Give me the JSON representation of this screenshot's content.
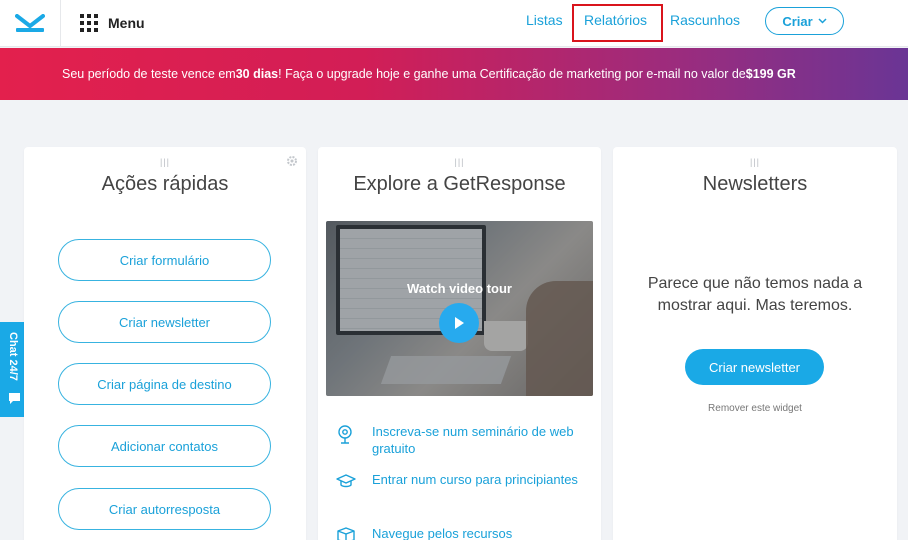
{
  "nav": {
    "menu_label": "Menu",
    "links": [
      "Listas",
      "Relatórios",
      "Rascunhos"
    ],
    "create_label": "Criar"
  },
  "banner": {
    "part1": "Seu período de teste vence em ",
    "days": "30 dias",
    "part2": "! Faça o upgrade hoje e ganhe uma Certificação de marketing por e-mail no valor de ",
    "price": "$199 GR"
  },
  "quick_actions": {
    "title": "Ações rápidas",
    "buttons": [
      "Criar formulário",
      "Criar newsletter",
      "Criar página de destino",
      "Adicionar contatos",
      "Criar autorresposta"
    ]
  },
  "explore": {
    "title": "Explore a GetResponse",
    "video_label": "Watch video tour",
    "resources": [
      {
        "icon": "webinar-icon",
        "label": "Inscreva-se num seminário de web gratuito"
      },
      {
        "icon": "graduation-cap-icon",
        "label": "Entrar num curso para principiantes"
      },
      {
        "icon": "box-icon",
        "label": "Navegue pelos recursos"
      }
    ]
  },
  "newsletters": {
    "title": "Newsletters",
    "empty_text": "Parece que não temos nada a mostrar aqui. Mas teremos.",
    "button": "Criar newsletter",
    "remove": "Remover este widget"
  },
  "chat": {
    "label": "Chat 24/7"
  },
  "colors": {
    "accent": "#1aa1d9",
    "highlight_border": "#d9141c",
    "banner_start": "#e3204d",
    "banner_end": "#6a3595"
  }
}
